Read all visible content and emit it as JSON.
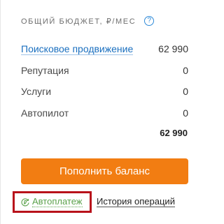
{
  "budget": {
    "title": "Общий бюджет, ₽/мес",
    "help_icon": "?",
    "rows": [
      {
        "label": "Поисковое продвижение",
        "value": "62 990",
        "is_link": true
      },
      {
        "label": "Репутация",
        "value": "0",
        "is_link": false
      },
      {
        "label": "Услуги",
        "value": "0",
        "is_link": false
      },
      {
        "label": "Автопилот",
        "value": "0",
        "is_link": false
      }
    ],
    "total": "62 990"
  },
  "actions": {
    "topup_label": "Пополнить баланс",
    "autopay_label": "Автоплатеж",
    "autopay_icon": "ruble-refresh-icon",
    "history_label": "История операций"
  },
  "colors": {
    "accent": "#f27d12",
    "link": "#1a6fbf",
    "autopay": "#5aa14a",
    "highlight": "#b8121b"
  }
}
